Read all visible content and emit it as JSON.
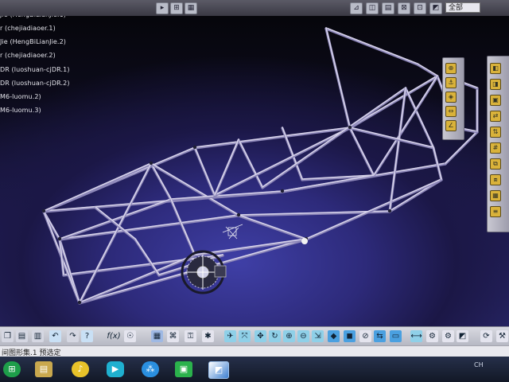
{
  "spec_tree": {
    "items": [
      {
        "label": "Jie (HengBiLianJie.1)"
      },
      {
        "label": "r (chejiadiaoer.1)"
      },
      {
        "label": "Jie (HengBiLianJie.2)"
      },
      {
        "label": "r (chejiadiaoer.2)"
      },
      {
        "label": "DR (luoshuan-cjDR.1)"
      },
      {
        "label": "DR (luoshuan-cjDR.2)"
      },
      {
        "label": "M6-luomu.2)"
      },
      {
        "label": "M6-luomu.3)"
      }
    ]
  },
  "top_toolbar": {
    "combo_value": "全部"
  },
  "bottom_toolbar": {
    "formula_label": "f(x)",
    "icons": [
      "undo-icon",
      "help-icon",
      "formula-icon",
      "comment-icon",
      "table-icon",
      "tree-icon",
      "lock-icon",
      "explode-icon",
      "manipulate-icon",
      "pan-icon",
      "rotate-icon",
      "fly-icon",
      "zoom-in-icon",
      "zoom-out-icon",
      "normal-view-icon",
      "iso-view-icon",
      "shading-icon",
      "hide-show-icon",
      "swap-icon",
      "measure-icon",
      "settings-icon",
      "analysis-icon",
      "sectioning-icon",
      "update-icon"
    ]
  },
  "status_bar": {
    "text": "间图形集.1 预选定"
  },
  "taskbar": {
    "apps": [
      "start-icon",
      "file-explorer-icon",
      "music-icon",
      "video-icon",
      "tasks-icon",
      "iqiyi-icon",
      "catia-icon"
    ],
    "tray_text": "CH"
  },
  "colors": {
    "frame_tube": "#d7d3ea",
    "frame_tube_shade": "#8c86b8",
    "viewport_center": "#3f3fa6",
    "toolbar_accent": "#d9b23a"
  }
}
